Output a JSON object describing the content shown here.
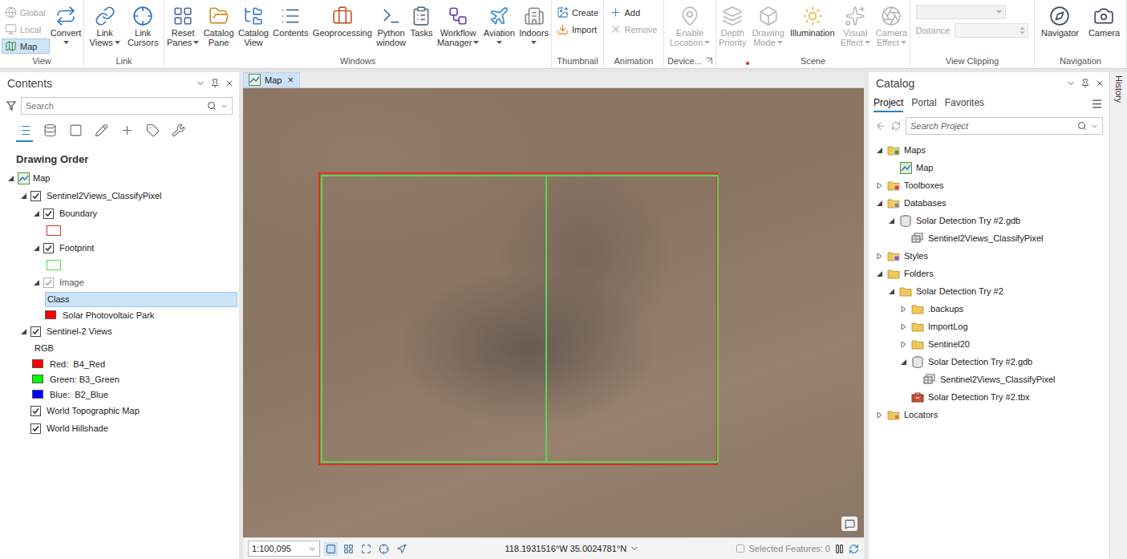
{
  "ribbon": {
    "groups": [
      {
        "label": "View",
        "launcher": false,
        "alert": false,
        "tools": [
          {
            "kind": "small",
            "lines": [
              "Global"
            ],
            "disabled": true,
            "selected": false,
            "dropdown": false
          },
          {
            "kind": "small",
            "lines": [
              "Local"
            ],
            "disabled": true,
            "selected": false,
            "dropdown": false
          },
          {
            "kind": "small",
            "lines": [
              "Map"
            ],
            "disabled": false,
            "selected": true,
            "dropdown": false
          },
          {
            "kind": "large",
            "lines": [
              "Convert"
            ],
            "disabled": false,
            "selected": false,
            "dropdown": true
          }
        ]
      },
      {
        "label": "Link",
        "launcher": false,
        "alert": false,
        "tools": [
          {
            "kind": "large",
            "lines": [
              "Link",
              "Views"
            ],
            "disabled": false,
            "selected": false,
            "dropdown": true
          },
          {
            "kind": "large",
            "lines": [
              "Link",
              "Cursors"
            ],
            "disabled": false,
            "selected": false,
            "dropdown": false
          }
        ]
      },
      {
        "label": "Windows",
        "launcher": false,
        "alert": false,
        "tools": [
          {
            "kind": "large",
            "lines": [
              "Reset",
              "Panes"
            ],
            "disabled": false,
            "selected": false,
            "dropdown": true
          },
          {
            "kind": "large",
            "lines": [
              "Catalog",
              "Pane"
            ],
            "disabled": false,
            "selected": false,
            "dropdown": false
          },
          {
            "kind": "large",
            "lines": [
              "Catalog",
              "View"
            ],
            "disabled": false,
            "selected": false,
            "dropdown": false
          },
          {
            "kind": "large",
            "lines": [
              "Contents"
            ],
            "disabled": false,
            "selected": false,
            "dropdown": false
          },
          {
            "kind": "large",
            "lines": [
              "Geoprocessing"
            ],
            "disabled": false,
            "selected": false,
            "dropdown": false
          },
          {
            "kind": "large",
            "lines": [
              "Python",
              "window"
            ],
            "disabled": false,
            "selected": false,
            "dropdown": false
          },
          {
            "kind": "large",
            "lines": [
              "Tasks"
            ],
            "disabled": false,
            "selected": false,
            "dropdown": false
          },
          {
            "kind": "large",
            "lines": [
              "Workflow",
              "Manager"
            ],
            "disabled": false,
            "selected": false,
            "dropdown": true
          },
          {
            "kind": "large",
            "lines": [
              "Aviation"
            ],
            "disabled": false,
            "selected": false,
            "dropdown": true
          },
          {
            "kind": "large",
            "lines": [
              "Indoors"
            ],
            "disabled": false,
            "selected": false,
            "dropdown": true
          }
        ]
      },
      {
        "label": "Thumbnail",
        "launcher": false,
        "alert": false,
        "tools": [
          {
            "kind": "small",
            "lines": [
              "Create"
            ],
            "disabled": false,
            "selected": false,
            "dropdown": false
          },
          {
            "kind": "small",
            "lines": [
              "Import"
            ],
            "disabled": false,
            "selected": false,
            "dropdown": false
          }
        ]
      },
      {
        "label": "Animation",
        "launcher": false,
        "alert": false,
        "tools": [
          {
            "kind": "small",
            "lines": [
              "Add"
            ],
            "disabled": false,
            "selected": false,
            "dropdown": false
          },
          {
            "kind": "small",
            "lines": [
              "Remove"
            ],
            "disabled": true,
            "selected": false,
            "dropdown": false
          }
        ]
      },
      {
        "label": "Device...",
        "launcher": true,
        "alert": false,
        "tools": [
          {
            "kind": "large",
            "lines": [
              "Enable",
              "Location"
            ],
            "disabled": true,
            "selected": false,
            "dropdown": true
          }
        ]
      },
      {
        "label": "Scene",
        "launcher": false,
        "alert": true,
        "tools": [
          {
            "kind": "large",
            "lines": [
              "Depth",
              "Priority"
            ],
            "disabled": true,
            "selected": false,
            "dropdown": false
          },
          {
            "kind": "large",
            "lines": [
              "Drawing",
              "Mode"
            ],
            "disabled": true,
            "selected": false,
            "dropdown": true
          },
          {
            "kind": "large",
            "lines": [
              "Illumination"
            ],
            "disabled": false,
            "selected": false,
            "dropdown": false
          },
          {
            "kind": "large",
            "lines": [
              "Visual",
              "Effect"
            ],
            "disabled": true,
            "selected": false,
            "dropdown": true
          },
          {
            "kind": "large",
            "lines": [
              "Camera",
              "Effect"
            ],
            "disabled": true,
            "selected": false,
            "dropdown": true
          }
        ]
      },
      {
        "label": "View Clipping",
        "launcher": false,
        "alert": false,
        "tools": [
          {
            "kind": "combo",
            "lines": [],
            "disabled": true,
            "selected": false,
            "dropdown": true
          },
          {
            "kind": "field",
            "lines": [
              "Distance"
            ],
            "disabled": true,
            "selected": false,
            "dropdown": false
          }
        ]
      },
      {
        "label": "Navigation",
        "launcher": false,
        "alert": false,
        "tools": [
          {
            "kind": "large",
            "lines": [
              "Navigator"
            ],
            "disabled": false,
            "selected": false,
            "dropdown": false
          },
          {
            "kind": "large",
            "lines": [
              "Camera"
            ],
            "disabled": false,
            "selected": false,
            "dropdown": false
          }
        ]
      }
    ]
  },
  "contents": {
    "title": "Contents",
    "search": {
      "placeholder": "Search"
    },
    "heading": "Drawing Order",
    "tree": [
      {
        "kind": "map",
        "level": 0,
        "label": "Map",
        "expanded": true
      },
      {
        "kind": "layer",
        "level": 1,
        "label": "Sentinel2Views_ClassifyPixel",
        "expanded": true,
        "checked": true,
        "disabled": false
      },
      {
        "kind": "layer",
        "level": 2,
        "label": "Boundary",
        "expanded": true,
        "checked": true,
        "disabled": false
      },
      {
        "kind": "swatch",
        "level": 3,
        "style": "outline",
        "color": "#e0301e"
      },
      {
        "kind": "layer",
        "level": 2,
        "label": "Footprint",
        "expanded": true,
        "checked": true,
        "disabled": false
      },
      {
        "kind": "swatch",
        "level": 3,
        "style": "outline",
        "color": "#55d655"
      },
      {
        "kind": "layer",
        "level": 2,
        "label": "Image",
        "expanded": true,
        "checked": true,
        "disabled": true
      },
      {
        "kind": "heading",
        "level": 3,
        "label": "Class",
        "selected": true
      },
      {
        "kind": "legend",
        "level": 3,
        "label": "Solar Photovoltaic Park",
        "color": "#ff0000"
      },
      {
        "kind": "layer",
        "level": 1,
        "label": "Sentinel-2 Views",
        "expanded": true,
        "checked": true,
        "disabled": false
      },
      {
        "kind": "heading",
        "level": 2,
        "label": "RGB",
        "selected": false
      },
      {
        "kind": "legend",
        "level": 2,
        "label": "Red:  B4_Red",
        "color": "#ff0000"
      },
      {
        "kind": "legend",
        "level": 2,
        "label": "Green: B3_Green",
        "color": "#00ff00"
      },
      {
        "kind": "legend",
        "level": 2,
        "label": "Blue:  B2_Blue",
        "color": "#0000ff"
      },
      {
        "kind": "layer",
        "level": 1,
        "label": "World Topographic Map",
        "expanded": null,
        "checked": true,
        "disabled": false
      },
      {
        "kind": "layer",
        "level": 1,
        "label": "World Hillshade",
        "expanded": null,
        "checked": true,
        "disabled": false
      }
    ]
  },
  "map_tab": {
    "label": "Map",
    "close": "×",
    "selected": true
  },
  "status_bar": {
    "scale": "1:100,095",
    "coordinates": "118.1931516°W 35.0024781°N",
    "selection": "Selected Features: 0"
  },
  "catalog": {
    "title": "Catalog",
    "tabs": [
      {
        "label": "Project",
        "selected": true
      },
      {
        "label": "Portal",
        "selected": false
      },
      {
        "label": "Favorites",
        "selected": false
      }
    ],
    "search": {
      "placeholder": "Search Project"
    },
    "tree": [
      {
        "kind": "maps",
        "level": 0,
        "label": "Maps",
        "expanded": true
      },
      {
        "kind": "map",
        "level": 1,
        "label": "Map",
        "expanded": null
      },
      {
        "kind": "toolboxes",
        "level": 0,
        "label": "Toolboxes",
        "expanded": false
      },
      {
        "kind": "databases",
        "level": 0,
        "label": "Databases",
        "expanded": true
      },
      {
        "kind": "gdb",
        "level": 1,
        "label": "Solar Detection Try #2.gdb",
        "expanded": true
      },
      {
        "kind": "raster",
        "level": 2,
        "label": "Sentinel2Views_ClassifyPixel",
        "expanded": null
      },
      {
        "kind": "styles",
        "level": 0,
        "label": "Styles",
        "expanded": false
      },
      {
        "kind": "folders",
        "level": 0,
        "label": "Folders",
        "expanded": true
      },
      {
        "kind": "folder",
        "level": 1,
        "label": "Solar Detection Try #2",
        "expanded": true
      },
      {
        "kind": "folder",
        "level": 2,
        "label": ".backups",
        "expanded": false
      },
      {
        "kind": "folder",
        "level": 2,
        "label": "ImportLog",
        "expanded": false
      },
      {
        "kind": "folder",
        "level": 2,
        "label": "Sentinel20",
        "expanded": false
      },
      {
        "kind": "gdb",
        "level": 2,
        "label": "Solar Detection Try #2.gdb",
        "expanded": true
      },
      {
        "kind": "raster",
        "level": 3,
        "label": "Sentinel2Views_ClassifyPixel",
        "expanded": null
      },
      {
        "kind": "toolbox",
        "level": 2,
        "label": "Solar Detection Try #2.tbx",
        "expanded": null
      },
      {
        "kind": "locators",
        "level": 0,
        "label": "Locators",
        "expanded": false
      }
    ]
  },
  "history": {
    "label": "History"
  }
}
